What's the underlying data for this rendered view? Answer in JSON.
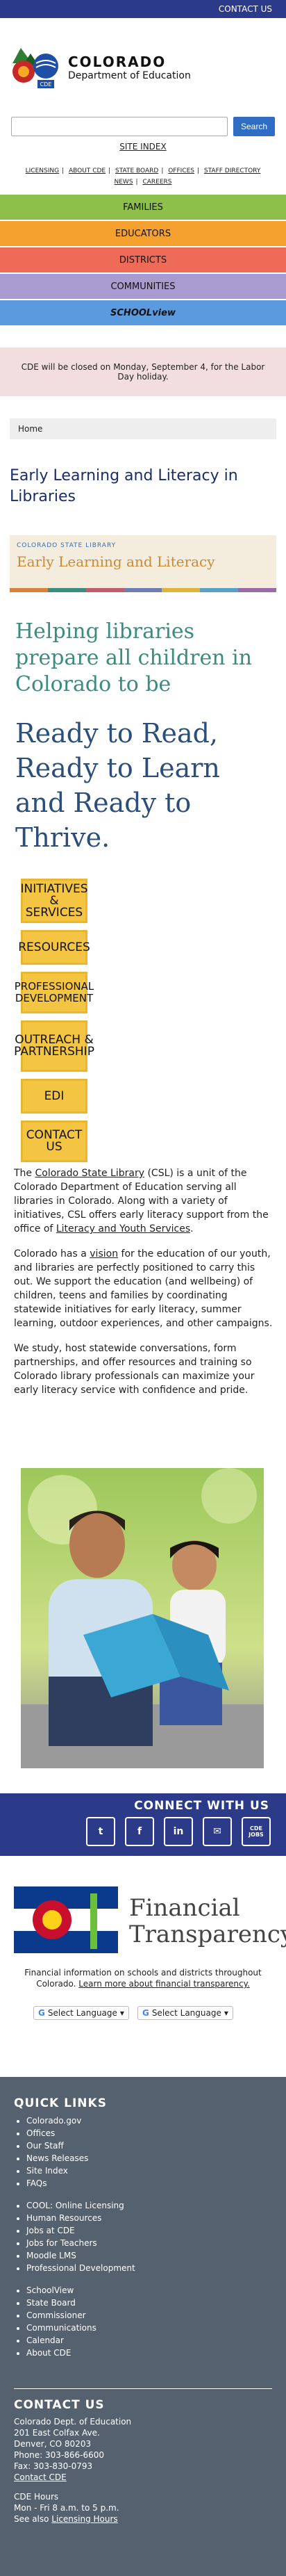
{
  "topbar": {
    "contact": "CONTACT US"
  },
  "logo": {
    "line1": "COLORADO",
    "line2": "Department of Education",
    "badge": "CDE"
  },
  "search": {
    "placeholder": "",
    "button": "Search"
  },
  "site_index": "SITE INDEX",
  "util_nav": [
    "LICENSING",
    "ABOUT CDE",
    "STATE BOARD",
    "OFFICES",
    "STAFF DIRECTORY",
    "NEWS",
    "CAREERS"
  ],
  "main_nav": [
    {
      "label": "FAMILIES",
      "color": "#8cc04a"
    },
    {
      "label": "EDUCATORS",
      "color": "#f4a12f"
    },
    {
      "label": "DISTRICTS",
      "color": "#ee6c57"
    },
    {
      "label": "COMMUNITIES",
      "color": "#a89bd0"
    },
    {
      "label": "SCHOOLview",
      "color": "#5a9be0"
    }
  ],
  "alert": "CDE will be closed on Monday, September 4, for the Labor Day holiday.",
  "breadcrumb": "Home",
  "page_title": "Early Learning and Literacy in Libraries",
  "banner": {
    "small": "COLORADO STATE LIBRARY",
    "big": "Early Learning and Literacy"
  },
  "helping": "Helping libraries prepare all children in Colorado to be",
  "ready": "Ready to Read, Ready to Learn and Ready to Thrive.",
  "side_nav": [
    "INITIATIVES & SERVICES",
    "RESOURCES",
    "PROFESSIONAL DEVELOPMENT",
    "OUTREACH & PARTNERSHIP",
    "EDI",
    "CONTACT US"
  ],
  "body": {
    "p1a": "The ",
    "p1_link": "Colorado State Library",
    "p1b": " (CSL) is a unit of the Colorado Department of Education serving all libraries in Colorado. Along with a variety of initiatives, CSL offers early literacy support from the office of ",
    "p1_link2": "Literacy and Youth Services",
    "p1c": ".",
    "p2a": "Colorado has a ",
    "p2_link": "vision",
    "p2b": " for the education of our youth, and libraries are perfectly positioned to carry this out. We support the education (and wellbeing) of children, teens and families by coordinating statewide initiatives for early literacy, summer learning, outdoor experiences, and other campaigns.",
    "p3": "We study, host statewide conversations, form partnerships, and offer resources and training so Colorado library professionals can maximize your early literacy service with confidence and pride."
  },
  "connect": {
    "label": "CONNECT WITH US",
    "icons": [
      "twitter-icon",
      "facebook-icon",
      "linkedin-icon",
      "email-icon",
      "cde-jobs-icon"
    ],
    "jobs_label": "CDE JOBS"
  },
  "financial": {
    "title1": "Financial",
    "title2": "Transparency",
    "desc": "Financial information on schools and districts throughout Colorado. ",
    "desc_link": "Learn more about financial transparency.",
    "translate1": "Select Language",
    "translate2": "Select Language"
  },
  "footer": {
    "quick_links_title": "QUICK LINKS",
    "group1": [
      "Colorado.gov",
      "Offices",
      "Our Staff",
      "News Releases",
      "Site Index",
      "FAQs"
    ],
    "group2": [
      "COOL: Online Licensing",
      "Human Resources",
      "Jobs at CDE",
      "Jobs for Teachers",
      "Moodle LMS",
      "Professional Development"
    ],
    "group3": [
      "SchoolView",
      "State Board",
      "Commissioner",
      "Communications",
      "Calendar",
      "About CDE"
    ],
    "contact_title": "CONTACT US",
    "contact_lines": [
      "Colorado Dept. of Education",
      "201 East Colfax Ave.",
      "Denver, CO 80203",
      "Phone: 303-866-6600",
      "Fax: 303-830-0793"
    ],
    "contact_link": "Contact CDE",
    "hours_title": "CDE Hours",
    "hours": "Mon - Fri 8 a.m. to 5 p.m.",
    "licensing_a": "See also ",
    "licensing_link": "Licensing Hours"
  }
}
